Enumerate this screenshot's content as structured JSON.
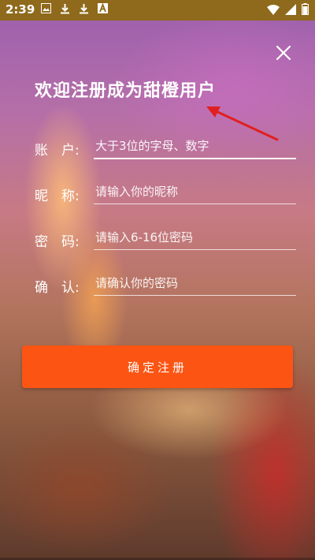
{
  "status_bar": {
    "time": "2:39",
    "left_icons": [
      "image-icon",
      "download-icon",
      "download-icon",
      "app-icon"
    ],
    "right_icons": [
      "wifi-icon",
      "signal-icon",
      "battery-icon"
    ]
  },
  "form": {
    "title": "欢迎注册成为甜橙用户",
    "fields": [
      {
        "label": "账　户:",
        "placeholder": "大于3位的字母、数字"
      },
      {
        "label": "昵　称:",
        "placeholder": "请输入你的昵称"
      },
      {
        "label": "密　码:",
        "placeholder": "请输入6-16位密码"
      },
      {
        "label": "确　认:",
        "placeholder": "请确认你的密码"
      }
    ],
    "submit_label": "确定注册"
  },
  "colors": {
    "status_bar": "#8f6a1c",
    "button": "#fb5413",
    "annotation_arrow": "#e02020"
  }
}
